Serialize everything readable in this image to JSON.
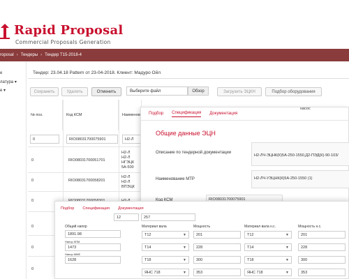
{
  "header": {
    "title": "Rapid Proposal",
    "subtitle": "Commercial Proposals Generation"
  },
  "breadcrumb": [
    "roposal",
    "Тендеры",
    "Тендер Т15-2018-4"
  ],
  "sidebar": {
    "items": [
      "е",
      "латура",
      "е"
    ]
  },
  "main": {
    "title": "Тендер: 23.04.18 Pattern от 23-04-2018. Клиент: Мадуро Ойл"
  },
  "toolbar": {
    "save": "Сохранить",
    "delete": "Удалить",
    "cancel": "Отменить",
    "file_placeholder": "Выберите файл",
    "browse": "Обзор",
    "upload": "Загрузить ЭЦКН",
    "equipment": "Подбор оборудования"
  },
  "table": {
    "headers": [
      "№ поз.",
      "Код КСМ",
      "Наименова"
    ],
    "filter": {
      "pos": "0",
      "code": "RIO08031700075901",
      "name": "Н2-Л"
    },
    "rows": [
      {
        "pos": "0",
        "code": "RIO08031700051701",
        "name": [
          "Н2-Л",
          "Н2-Л",
          "НГЭЦК",
          "5А-500"
        ]
      },
      {
        "pos": "0",
        "code": "RIO08031700058201",
        "name": [
          "Н2-Л",
          "Н2-Л",
          "ВПЭЦК"
        ]
      },
      {
        "pos": "0",
        "code": "RIO08031700058301",
        "name": [
          "Н2-Л"
        ]
      },
      {
        "pos": "0",
        "code": "",
        "name": []
      },
      {
        "pos": "0",
        "code": "",
        "name": []
      },
      {
        "pos": "0",
        "code": "",
        "name": []
      }
    ]
  },
  "modal1": {
    "tabs": [
      "Подбор",
      "Спецификация",
      "Документация"
    ],
    "heading": "Общие данные ЭЦН",
    "fields": [
      {
        "label": "Описание по тендерной документации",
        "value": "Н2-ЛЧ-ЭЦНК(К)5А-250-1550,Д2-ПЭД(К)-90-103/"
      },
      {
        "label": "Наименование МТР",
        "value": "Н2-ЛЧ-УЭЦНК(К)5А-250-1550 (1)"
      },
      {
        "label": "Код КСМ",
        "value": "RIO08031700075901"
      }
    ],
    "column_header": "насос"
  },
  "modal2": {
    "tabs": [
      "Подбор",
      "Спецификация",
      "Документация"
    ],
    "top_values": [
      "12",
      "257"
    ],
    "general_label": "Общий напор",
    "general_value": "1891.98",
    "head_label_1": "Напор КПМ",
    "head_value_1": "1473",
    "head_label_2": "Напор ММЕ",
    "head_value_2": "1628",
    "col_headers": [
      "Материал вала",
      "Мощность",
      "Материал вала н.с.",
      "Мощность н.с."
    ],
    "rows": [
      [
        "Т12",
        "201",
        "Т12",
        "201"
      ],
      [
        "Т14",
        "228",
        "Т14",
        "228"
      ],
      [
        "Т18",
        "300",
        "Т18",
        "300"
      ],
      [
        "ЯНС 718",
        "353",
        "ЯНС 718",
        "353"
      ]
    ]
  },
  "colors": {
    "brand": "#c8102e",
    "breadcrumb_bg": "#8a3b3b"
  }
}
